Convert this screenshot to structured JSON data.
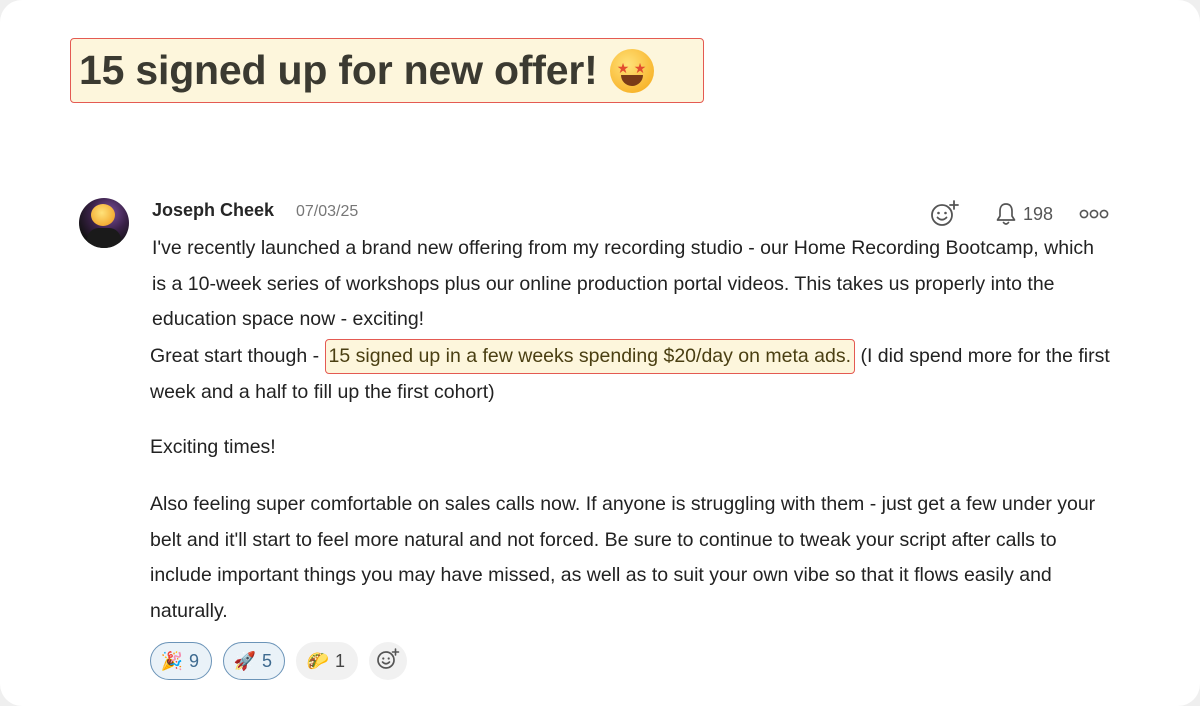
{
  "post": {
    "title": "15 signed up for new offer!",
    "title_emoji": "star-struck-icon",
    "author": "Joseph Cheek",
    "date": "07/03/25",
    "notification_count": "198",
    "paragraph1": "I've recently launched a brand new offering from my recording studio - our Home Recording Bootcamp, which is a 10-week series of workshops plus our online production portal videos. This takes us properly into the education space now - exciting!",
    "paragraph2_before": "Great start though - ",
    "paragraph2_highlight": "15 signed up in a few weeks spending $20/day on meta ads.",
    "paragraph2_after": " (I did spend more for the first week and a half to fill up the first cohort)",
    "paragraph3": "Exciting times!",
    "paragraph4": "Also feeling super comfortable on sales calls now. If anyone is struggling with them - just get a few under your belt and it'll start to feel more natural and not forced. Be sure to continue to tweak your script after calls to include important things you may have missed, as well as to suit your own vibe so that it flows easily and naturally."
  },
  "reactions": [
    {
      "icon": "party-popper-icon",
      "glyph": "🎉",
      "count": "9",
      "active": true
    },
    {
      "icon": "rocket-icon",
      "glyph": "🚀",
      "count": "5",
      "active": true
    },
    {
      "icon": "taco-icon",
      "glyph": "🌮",
      "count": "1",
      "active": false
    }
  ],
  "colors": {
    "highlight_bg": "#fdf6dc",
    "highlight_border": "#e45a52",
    "active_reaction_border": "#6b94b8"
  }
}
